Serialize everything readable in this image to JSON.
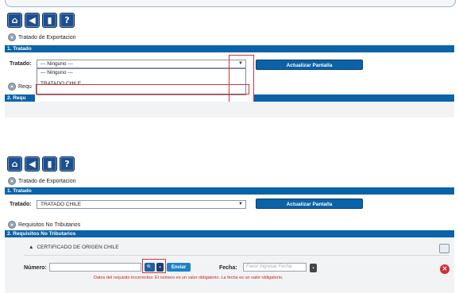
{
  "screen1": {
    "toolbar": {
      "icons": [
        "home-icon",
        "back-icon",
        "print-icon",
        "help-icon"
      ],
      "glyphs": [
        "⌂",
        "◀",
        "▮",
        "?"
      ]
    },
    "section_title": "Tratado de Exportacion",
    "bar1": "1. Tratado",
    "tratado_label": "Tratado:",
    "select_value": "--- Ninguno ---",
    "update_button": "Actualizar Pantalla",
    "dropdown_options": [
      "--- Ninguno ---",
      "TRATADO CHILE"
    ],
    "collapsed_label": "Requ",
    "bar2": "2. Requ"
  },
  "screen2": {
    "toolbar": {
      "icons": [
        "home-icon",
        "back-icon",
        "print-icon",
        "help-icon"
      ],
      "glyphs": [
        "⌂",
        "◀",
        "▮",
        "?"
      ]
    },
    "section_title": "Tratado de Exportacion",
    "bar1": "1. Tratado",
    "tratado_label": "Tratado:",
    "select_value": "TRATADO CHILE",
    "update_button": "Actualizar Pantalla",
    "requisitos_label": "Requisitos No Tributarios",
    "bar2": "2. Requisitos No Tributarios",
    "cert_title": "CERTIFICADO DE ORIGEN CHILE",
    "numero_label": "Número:",
    "enviar_button": "Enviar",
    "fecha_label": "Fecha:",
    "fecha_placeholder": "Favor Ingresar Fecha",
    "error_text": "Datos del requisito incorrectos: El número es un valor obligatorio. La fecha es un valor obligatorio."
  },
  "colors": {
    "accent": "#0a63a8",
    "highlight": "#d0343b",
    "error": "#c81f26"
  }
}
